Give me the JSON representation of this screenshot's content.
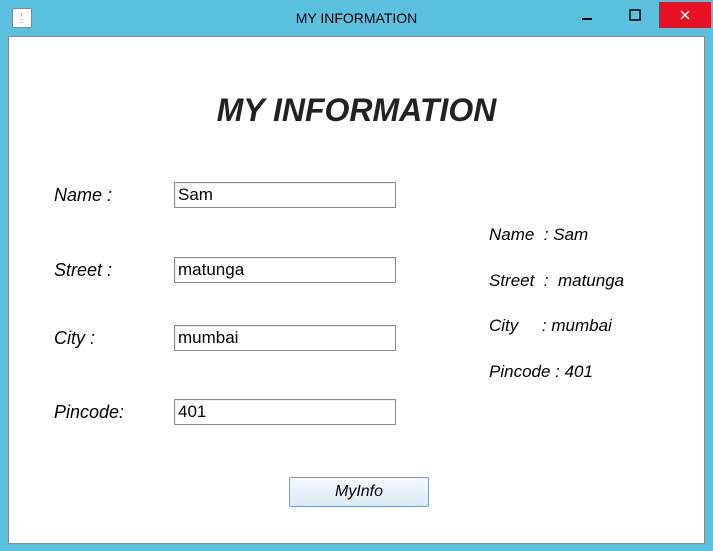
{
  "window": {
    "title": "MY INFORMATION"
  },
  "heading": "MY INFORMATION",
  "form": {
    "name_label": "Name :",
    "name_value": "Sam",
    "street_label": "Street :",
    "street_value": "matunga",
    "city_label": "City :",
    "city_value": "mumbai",
    "pincode_label": "Pincode:",
    "pincode_value": "401"
  },
  "output": {
    "line1": "Name  : Sam",
    "line2": "Street  :  matunga",
    "line3": "City     : mumbai",
    "line4": "Pincode : 401"
  },
  "button": {
    "submit": "MyInfo"
  }
}
